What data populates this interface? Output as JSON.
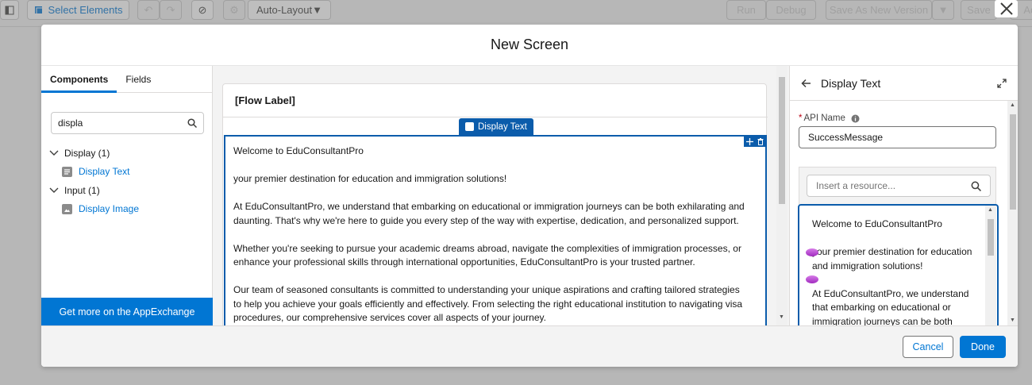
{
  "toolbar": {
    "select_elements": "Select Elements",
    "layout_mode": "Auto-Layout",
    "run": "Run",
    "debug": "Debug",
    "save_as_new_version": "Save As New Version",
    "save": "Save",
    "activate_partial": "Acti"
  },
  "modal": {
    "title": "New Screen"
  },
  "left_panel": {
    "tabs": [
      {
        "label": "Components",
        "active": true
      },
      {
        "label": "Fields",
        "active": false
      }
    ],
    "search_value": "displa",
    "groups": [
      {
        "label": "Display (1)",
        "items": [
          {
            "label": "Display Text",
            "icon": "display-text-icon"
          }
        ]
      },
      {
        "label": "Input (1)",
        "items": [
          {
            "label": "Display Image",
            "icon": "display-image-icon"
          }
        ]
      }
    ],
    "appexchange_label": "Get more on the AppExchange"
  },
  "canvas": {
    "flow_label": "[Flow Label]",
    "selected_component": "Display Text",
    "paragraphs": [
      "Welcome to EduConsultantPro",
      "your premier destination for education and immigration solutions!",
      "At EduConsultantPro, we understand that embarking on educational or immigration journeys can be both exhilarating and daunting. That's why we're here to guide you every step of the way with expertise, dedication, and personalized support.",
      "Whether you're seeking to pursue your academic dreams abroad, navigate the complexities of immigration processes, or enhance your professional skills through international opportunities, EduConsultantPro is your trusted partner.",
      "Our team of seasoned consultants is committed to understanding your unique aspirations and crafting tailored strategies to help you achieve your goals efficiently and effectively. From selecting the right educational institution to navigating visa procedures, our comprehensive services cover all aspects of your journey."
    ]
  },
  "properties": {
    "title": "Display Text",
    "api_name_label": "API Name",
    "api_name_required_mark": "*",
    "api_name_value": "SuccessMessage",
    "resource_placeholder": "Insert a resource...",
    "editor_lines": [
      "Welcome to EduConsultantPro",
      "your premier destination for education and immigration solutions!",
      "At EduConsultantPro, we understand that embarking on educational or immigration journeys can be both"
    ]
  },
  "footer": {
    "cancel": "Cancel",
    "done": "Done"
  },
  "colors": {
    "brand": "#0176d3",
    "selection": "#0b5cab",
    "required": "#ba0517"
  }
}
